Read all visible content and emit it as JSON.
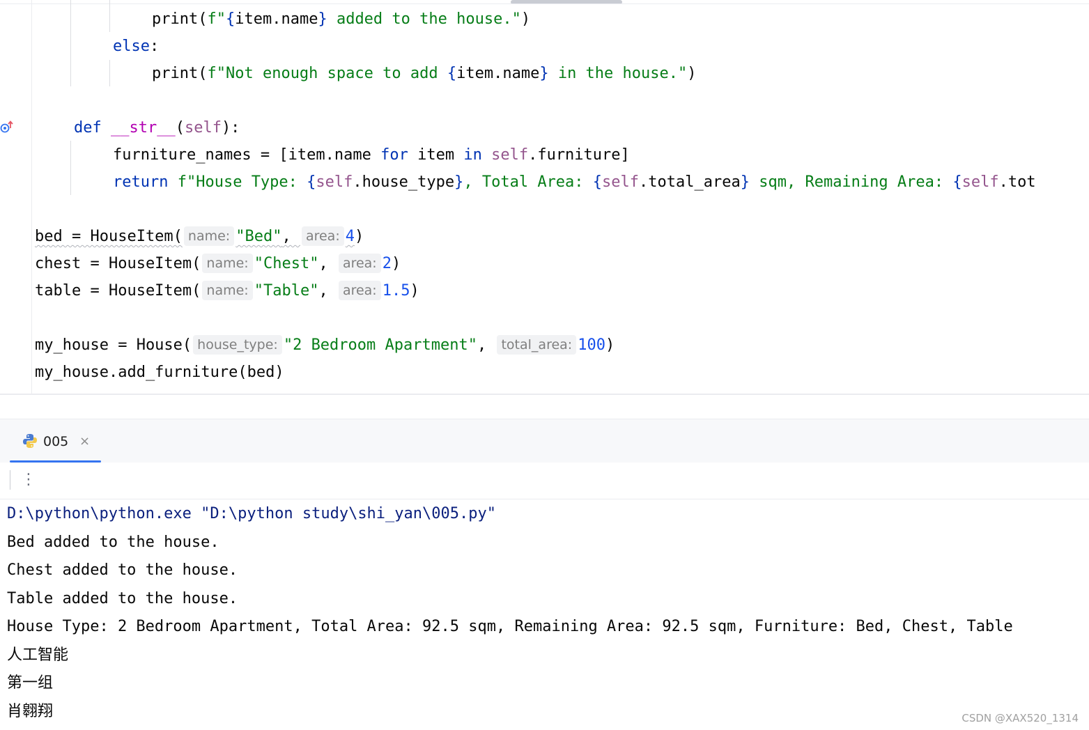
{
  "editor": {
    "lines": [
      {
        "id": "l1",
        "tokens": [
          {
            "t": "print",
            "c": "fn"
          },
          {
            "t": "(",
            "c": "br"
          },
          {
            "t": "f\"",
            "c": "str"
          },
          {
            "t": "{",
            "c": "kw"
          },
          {
            "t": "item.name",
            "c": "fn"
          },
          {
            "t": "}",
            "c": "kw"
          },
          {
            "t": " added to the house.\"",
            "c": "str"
          },
          {
            "t": ")",
            "c": "br"
          }
        ]
      },
      {
        "id": "l2",
        "tokens": [
          {
            "t": "else",
            "c": "kw"
          },
          {
            "t": ":",
            "c": "br"
          }
        ]
      },
      {
        "id": "l3",
        "tokens": [
          {
            "t": "print",
            "c": "fn"
          },
          {
            "t": "(",
            "c": "br"
          },
          {
            "t": "f\"Not enough space to add ",
            "c": "str"
          },
          {
            "t": "{",
            "c": "kw"
          },
          {
            "t": "item.name",
            "c": "fn"
          },
          {
            "t": "}",
            "c": "kw"
          },
          {
            "t": " in the house.\"",
            "c": "str"
          },
          {
            "t": ")",
            "c": "br"
          }
        ]
      },
      {
        "id": "l5",
        "tokens": [
          {
            "t": "def ",
            "c": "kw"
          },
          {
            "t": "__str__",
            "c": "magic"
          },
          {
            "t": "(",
            "c": "br"
          },
          {
            "t": "self",
            "c": "self"
          },
          {
            "t": "):",
            "c": "br"
          }
        ]
      },
      {
        "id": "l6",
        "tokens": [
          {
            "t": "furniture_names = [item.name ",
            "c": "fn"
          },
          {
            "t": "for",
            "c": "kw"
          },
          {
            "t": " item ",
            "c": "fn"
          },
          {
            "t": "in",
            "c": "kw"
          },
          {
            "t": " ",
            "c": "fn"
          },
          {
            "t": "self",
            "c": "self"
          },
          {
            "t": ".furniture]",
            "c": "fn"
          }
        ]
      },
      {
        "id": "l7",
        "tokens": [
          {
            "t": "return",
            "c": "kw"
          },
          {
            "t": " f\"House Type: ",
            "c": "str"
          },
          {
            "t": "{",
            "c": "kw"
          },
          {
            "t": "self",
            "c": "self"
          },
          {
            "t": ".house_type",
            "c": "fn"
          },
          {
            "t": "}",
            "c": "kw"
          },
          {
            "t": ", Total Area: ",
            "c": "str"
          },
          {
            "t": "{",
            "c": "kw"
          },
          {
            "t": "self",
            "c": "self"
          },
          {
            "t": ".total_area",
            "c": "fn"
          },
          {
            "t": "}",
            "c": "kw"
          },
          {
            "t": " sqm, Remaining Area: ",
            "c": "str"
          },
          {
            "t": "{",
            "c": "kw"
          },
          {
            "t": "self",
            "c": "self"
          },
          {
            "t": ".tot",
            "c": "fn"
          }
        ]
      },
      {
        "id": "l9",
        "tokens": [
          {
            "t": "bed = HouseItem(",
            "c": "fn",
            "sq": true
          },
          {
            "t": "name:",
            "c": "hint"
          },
          {
            "t": "\"Bed\"",
            "c": "str",
            "sq": true
          },
          {
            "t": ", ",
            "c": "br",
            "sq": true
          },
          {
            "t": "area:",
            "c": "hint"
          },
          {
            "t": "4",
            "c": "num",
            "sq": true
          },
          {
            "t": ")",
            "c": "br"
          }
        ]
      },
      {
        "id": "l10",
        "tokens": [
          {
            "t": "chest = HouseItem(",
            "c": "fn"
          },
          {
            "t": "name:",
            "c": "hint"
          },
          {
            "t": "\"Chest\"",
            "c": "str"
          },
          {
            "t": ", ",
            "c": "br"
          },
          {
            "t": "area:",
            "c": "hint"
          },
          {
            "t": "2",
            "c": "num"
          },
          {
            "t": ")",
            "c": "br"
          }
        ]
      },
      {
        "id": "l11",
        "tokens": [
          {
            "t": "table = HouseItem(",
            "c": "fn"
          },
          {
            "t": "name:",
            "c": "hint"
          },
          {
            "t": "\"Table\"",
            "c": "str"
          },
          {
            "t": ", ",
            "c": "br"
          },
          {
            "t": "area:",
            "c": "hint"
          },
          {
            "t": "1.5",
            "c": "num"
          },
          {
            "t": ")",
            "c": "br"
          }
        ]
      },
      {
        "id": "l13",
        "tokens": [
          {
            "t": "my_house = House(",
            "c": "fn"
          },
          {
            "t": "house_type:",
            "c": "hint"
          },
          {
            "t": "\"2 Bedroom Apartment\"",
            "c": "str"
          },
          {
            "t": ", ",
            "c": "br"
          },
          {
            "t": "total_area:",
            "c": "hint"
          },
          {
            "t": "100",
            "c": "num"
          },
          {
            "t": ")",
            "c": "br"
          }
        ]
      },
      {
        "id": "l14",
        "tokens": [
          {
            "t": "my_house.add_furniture(bed)",
            "c": "fn"
          }
        ]
      }
    ]
  },
  "run_panel": {
    "tab_label": "005",
    "tab_close": "×",
    "more_label": "⋮",
    "tab_icon": "python-icon"
  },
  "console": {
    "command": "D:\\python\\python.exe \"D:\\python study\\shi_yan\\005.py\"",
    "output": [
      "Bed added to the house.",
      "Chest added to the house.",
      "Table added to the house.",
      "House Type: 2 Bedroom Apartment, Total Area: 92.5 sqm, Remaining Area: 92.5 sqm, Furniture: Bed, Chest, Table",
      "人工智能",
      "第一组",
      "肖翱翔"
    ]
  },
  "watermark": "CSDN @XAX520_1314",
  "colors": {
    "keyword": "#0033b3",
    "string": "#067d17",
    "number": "#1750eb",
    "self": "#94558d",
    "magic": "#b200b2",
    "command": "#0a1f7d",
    "accent": "#3574f0"
  }
}
